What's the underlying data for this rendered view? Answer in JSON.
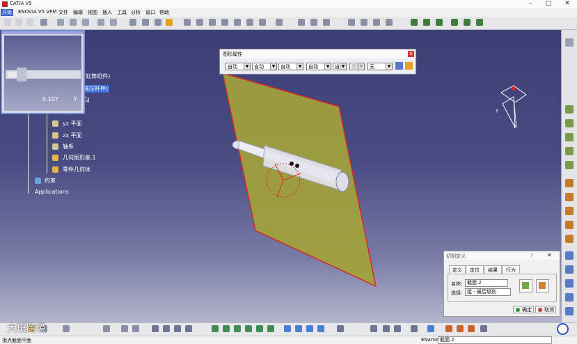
{
  "window": {
    "title": "CATIA V5",
    "minimize": "–",
    "maximize": "□",
    "close": "✕"
  },
  "menu": [
    {
      "label": "开始"
    },
    {
      "label": "ENOVIA V5 VPM"
    },
    {
      "label": "文件"
    },
    {
      "label": "编辑"
    },
    {
      "label": "视图"
    },
    {
      "label": "插入"
    },
    {
      "label": "工具"
    },
    {
      "label": "分析"
    },
    {
      "label": "窗口"
    },
    {
      "label": "帮助"
    }
  ],
  "tree": {
    "items": [
      {
        "label": "(缸筒组件)"
      },
      {
        "label": "液压杆件)"
      },
      {
        "label": "GJ"
      },
      {
        "label": "xy 平面"
      },
      {
        "label": "yz 平面"
      },
      {
        "label": "zx 平面"
      },
      {
        "label": "轴系"
      },
      {
        "label": "几何图形集.1"
      },
      {
        "label": "零件几何体"
      },
      {
        "label": "约束"
      },
      {
        "label": "Applications"
      }
    ]
  },
  "preview": {
    "value": "0.107",
    "axis": "y"
  },
  "graphic_properties": {
    "title": "图形属性",
    "fields": [
      {
        "value": "自动"
      },
      {
        "value": "自动"
      },
      {
        "value": "自动"
      },
      {
        "value": "自动"
      },
      {
        "value": "自动"
      },
      {
        "value": "图层"
      },
      {
        "value": "无"
      }
    ],
    "dropdown_arrow": "▼",
    "close_label": "x"
  },
  "cut_dialog": {
    "title": "切割定义",
    "help_label": "?",
    "close_label": "✕",
    "tabs": [
      {
        "label": "定义"
      },
      {
        "label": "定位"
      },
      {
        "label": "结果"
      },
      {
        "label": "行为"
      }
    ],
    "name_label": "名称:",
    "name_value": "截面.2",
    "select_label": "选择:",
    "select_value": "组 - 最后级别",
    "ok_label": "确定",
    "cancel_label": "取消"
  },
  "compass": {
    "axis_x": "x",
    "axis_y": "y",
    "axis_z": "z"
  },
  "status": {
    "message": "指点截面平面",
    "field_label": "EName",
    "field_value": "截面.2"
  },
  "watermark": "大斑跨境",
  "colors": {
    "viewport_top": "#3b3f75",
    "plane_fill": "#a3a23a",
    "plane_edge": "#d8262a",
    "selection": "#3b6ed6"
  }
}
